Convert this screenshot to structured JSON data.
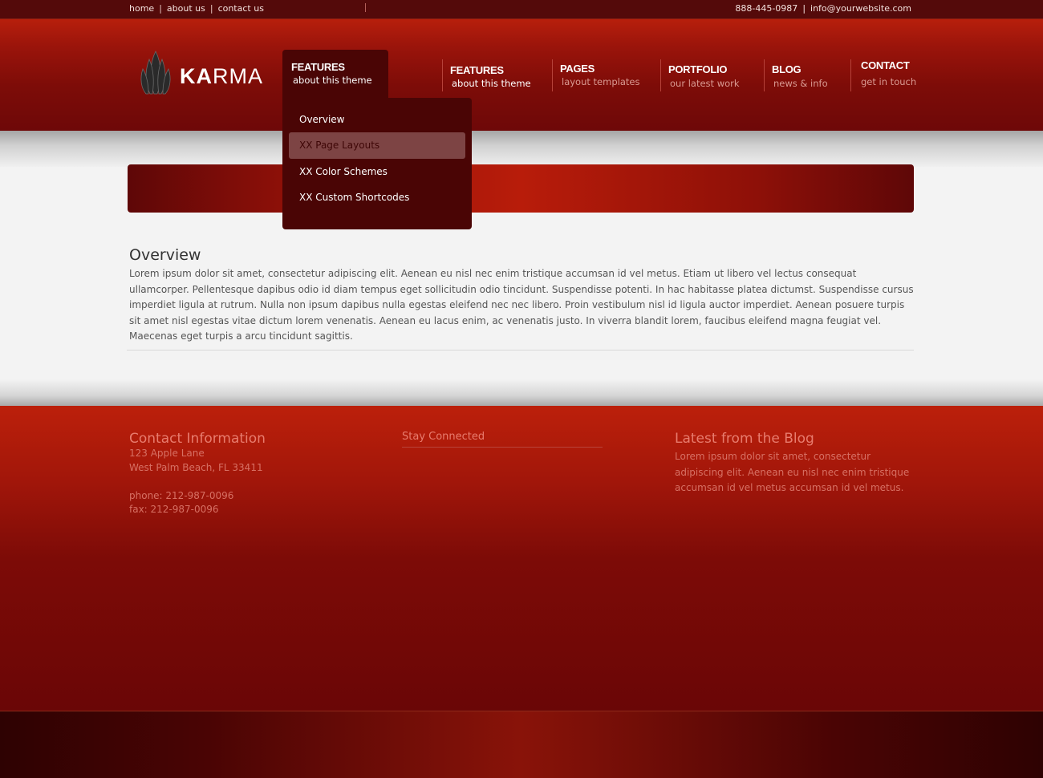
{
  "topbar": {
    "links": [
      "home",
      "about us",
      "contact us"
    ],
    "phone": "888-445-0987",
    "email": "info@yourwebsite.com"
  },
  "logo": {
    "bold": "KA",
    "rest": "RMA"
  },
  "nav": {
    "active": {
      "title": "FEATURES",
      "subtitle": "about this theme"
    },
    "items": [
      {
        "title": "FEATURES",
        "subtitle": "about this theme"
      },
      {
        "title": "PAGES",
        "subtitle": "layout templates"
      },
      {
        "title": "PORTFOLIO",
        "subtitle": "our latest work"
      },
      {
        "title": "BLOG",
        "subtitle": "news & info"
      },
      {
        "title": "CONTACT",
        "subtitle": "get in touch"
      }
    ]
  },
  "dropdown": {
    "items": [
      "Overview",
      "XX Page Layouts",
      "XX Color Schemes",
      "XX Custom Shortcodes"
    ],
    "highlighted_index": 1
  },
  "content": {
    "title": "Overview",
    "body": "Lorem ipsum dolor sit amet, consectetur adipiscing elit. Aenean eu nisl nec enim tristique accumsan id vel metus. Etiam ut libero vel lectus consequat ullamcorper. Pellentesque dapibus odio id diam tempus eget sollicitudin odio tincidunt. Suspendisse potenti. In hac habitasse platea dictumst. Suspendisse cursus imperdiet ligula at rutrum. Nulla non ipsum dapibus nulla egestas eleifend nec nec libero. Proin vestibulum nisl id ligula auctor imperdiet. Aenean posuere turpis sit amet nisl egestas vitae dictum lorem venenatis. Aenean eu lacus enim, ac venenatis justo. In viverra blandit lorem, faucibus eleifend magna feugiat vel. Maecenas eget turpis a arcu tincidunt sagittis."
  },
  "footer": {
    "contact": {
      "title": "Contact Information",
      "address1": "123 Apple Lane",
      "address2": "West Palm Beach, FL 33411",
      "phone": "phone: 212-987-0096",
      "fax": "fax: 212-987-0096"
    },
    "connected": {
      "title": "Stay Connected"
    },
    "blog": {
      "title": "Latest from the Blog",
      "text": "Lorem ipsum dolor sit amet, consectetur adipiscing elit. Aenean eu nisl nec enim tristique accumsan id vel metus accumsan id vel metus."
    }
  },
  "colors": {
    "brand_red": "#b71f0c",
    "dark_red": "#4a0505",
    "footer_text": "#d77064",
    "footer_title": "#e87c6e"
  }
}
